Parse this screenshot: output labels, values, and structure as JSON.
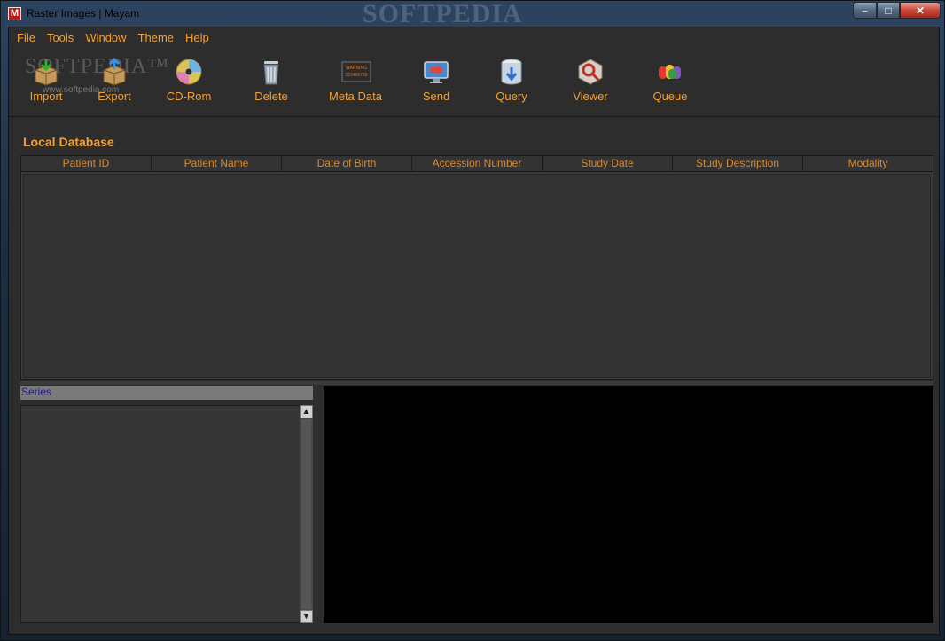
{
  "window": {
    "title": "Raster Images | Mayam",
    "brand_overlay": "SOFTPEDIA",
    "app_icon_letter": "M",
    "controls": {
      "minimize": "–",
      "maximize": "□",
      "close": "✕"
    }
  },
  "menu": [
    {
      "label": "File"
    },
    {
      "label": "Tools"
    },
    {
      "label": "Window"
    },
    {
      "label": "Theme"
    },
    {
      "label": "Help"
    }
  ],
  "watermark": {
    "text": "SOFTPEDIA™",
    "url": "www.softpedia.com"
  },
  "toolbar": [
    {
      "label": "Import",
      "icon": "import-box-icon"
    },
    {
      "label": "Export",
      "icon": "export-box-icon"
    },
    {
      "label": "CD-Rom",
      "icon": "cd-rom-icon"
    },
    {
      "label": "Delete",
      "icon": "trash-icon"
    },
    {
      "label": "Meta Data",
      "icon": "metadata-icon"
    },
    {
      "label": "Send",
      "icon": "send-icon"
    },
    {
      "label": "Query",
      "icon": "database-query-icon"
    },
    {
      "label": "Viewer",
      "icon": "viewer-icon"
    },
    {
      "label": "Queue",
      "icon": "queue-icon"
    }
  ],
  "metadata_icon_text": {
    "line1": "WARNING",
    "line2": "123456789"
  },
  "local_database": {
    "title": "Local Database",
    "columns": [
      "Patient ID",
      "Patient Name",
      "Date of Birth",
      "Accession Number",
      "Study Date",
      "Study Description",
      "Modality"
    ],
    "rows": []
  },
  "series": {
    "header": "Series",
    "items": []
  },
  "scroll": {
    "up": "▲",
    "down": "▼"
  },
  "colors": {
    "accent": "#f2a038",
    "panel": "#2d2d2d",
    "viewer": "#000000"
  }
}
